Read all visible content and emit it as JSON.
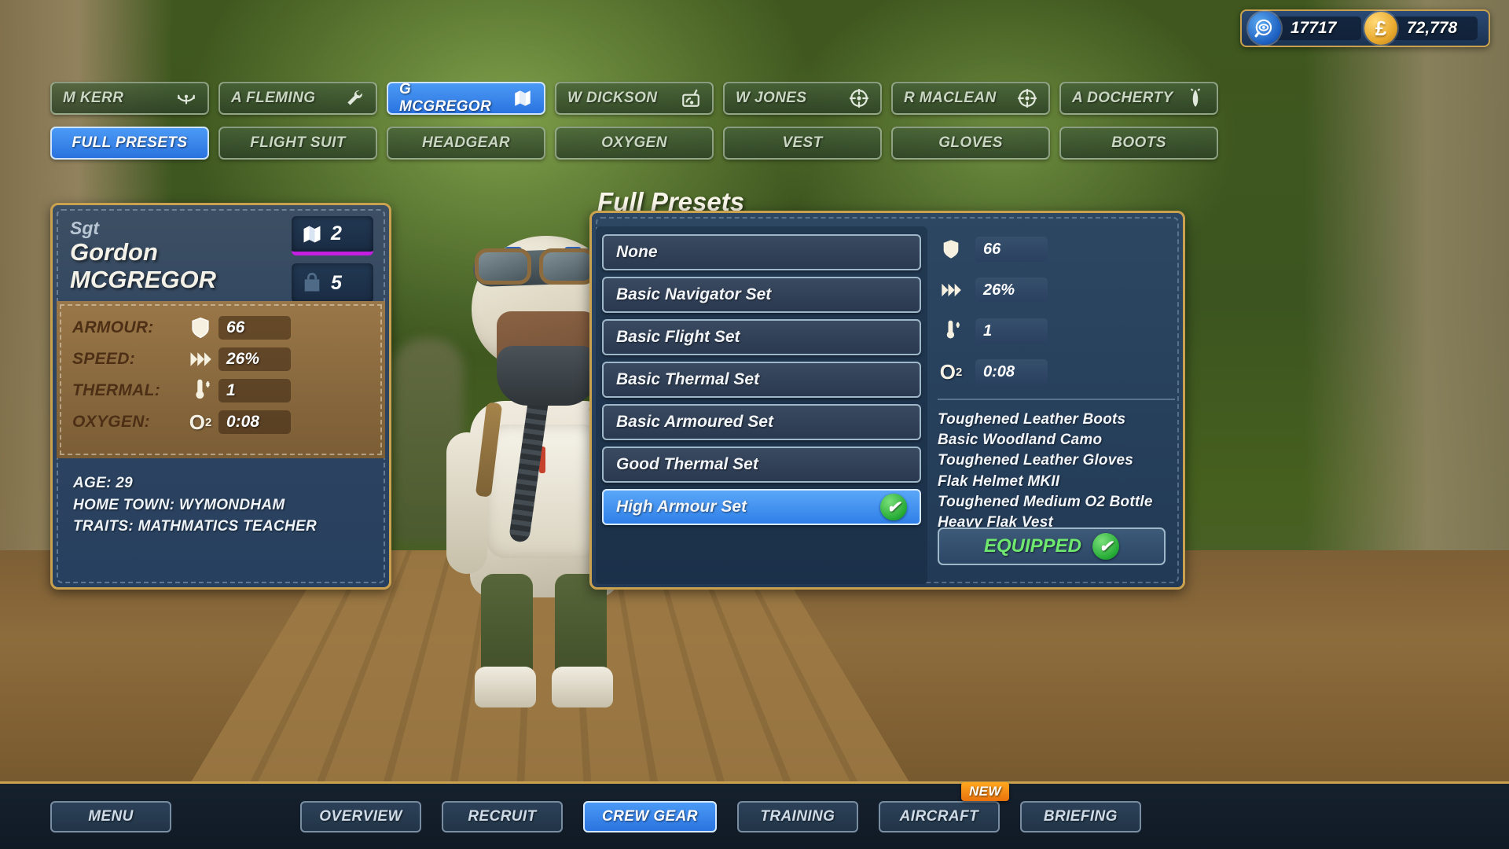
{
  "currency": {
    "research_icon": "research-eye-icon",
    "research_value": "17717",
    "money_icon": "pound-coin-icon",
    "money_symbol": "£",
    "money_value": "72,778"
  },
  "crew_tabs": [
    {
      "label": "M KERR",
      "icon": "yoke-icon",
      "active": false
    },
    {
      "label": "A FLEMING",
      "icon": "wrench-icon",
      "active": false
    },
    {
      "label": "G MCGREGOR",
      "icon": "map-icon",
      "active": true
    },
    {
      "label": "W DICKSON",
      "icon": "radio-icon",
      "active": false
    },
    {
      "label": "W JONES",
      "icon": "crosshair-icon",
      "active": false
    },
    {
      "label": "R MACLEAN",
      "icon": "crosshair-icon",
      "active": false
    },
    {
      "label": "A DOCHERTY",
      "icon": "bomb-icon",
      "active": false
    }
  ],
  "category_tabs": [
    {
      "label": "FULL PRESETS",
      "active": true
    },
    {
      "label": "FLIGHT SUIT",
      "active": false
    },
    {
      "label": "HEADGEAR",
      "active": false
    },
    {
      "label": "OXYGEN",
      "active": false
    },
    {
      "label": "VEST",
      "active": false
    },
    {
      "label": "GLOVES",
      "active": false
    },
    {
      "label": "BOOTS",
      "active": false
    }
  ],
  "character": {
    "rank": "Sgt",
    "first_name": "Gordon",
    "last_name": "MCGREGOR",
    "role_badge": {
      "icon": "map-icon",
      "value": "2",
      "accent": "#c41fe0"
    },
    "bag_badge": {
      "icon": "bag-icon",
      "value": "5"
    },
    "stats": [
      {
        "label": "ARMOUR:",
        "icon": "shield-icon",
        "value": "66"
      },
      {
        "label": "SPEED:",
        "icon": "chevrons-icon",
        "value": "26%"
      },
      {
        "label": "THERMAL:",
        "icon": "thermometer-icon",
        "value": "1"
      },
      {
        "label": "OXYGEN:",
        "icon": "o2-icon",
        "value": "0:08"
      }
    ],
    "bio": [
      "AGE: 29",
      "HOME TOWN: WYMONDHAM",
      "TRAITS: MATHMATICS TEACHER"
    ]
  },
  "presets_panel": {
    "title": "Full Presets",
    "items": [
      {
        "label": "None",
        "selected": false
      },
      {
        "label": "Basic Navigator Set",
        "selected": false
      },
      {
        "label": "Basic Flight Set",
        "selected": false
      },
      {
        "label": "Basic Thermal Set",
        "selected": false
      },
      {
        "label": "Basic Armoured Set",
        "selected": false
      },
      {
        "label": "Good Thermal Set",
        "selected": false
      },
      {
        "label": "High Armour Set",
        "selected": true
      }
    ],
    "detail_stats": [
      {
        "icon": "shield-icon",
        "value": "66"
      },
      {
        "icon": "chevrons-icon",
        "value": "26%"
      },
      {
        "icon": "thermometer-icon",
        "value": "1"
      },
      {
        "icon": "o2-icon",
        "value": "0:08"
      }
    ],
    "equipment": [
      "Toughened Leather Boots",
      "Basic Woodland Camo",
      "Toughened Leather Gloves",
      "Flak Helmet MKII",
      "Toughened Medium O2 Bottle",
      "Heavy Flak Vest"
    ],
    "equipped_label": "EQUIPPED"
  },
  "bottom_nav": [
    {
      "label": "MENU",
      "active": false,
      "badge": ""
    },
    {
      "label": "OVERVIEW",
      "active": false,
      "badge": ""
    },
    {
      "label": "RECRUIT",
      "active": false,
      "badge": ""
    },
    {
      "label": "CREW GEAR",
      "active": true,
      "badge": ""
    },
    {
      "label": "TRAINING",
      "active": false,
      "badge": ""
    },
    {
      "label": "AIRCRAFT",
      "active": false,
      "badge": "NEW"
    },
    {
      "label": "BRIEFING",
      "active": false,
      "badge": ""
    }
  ],
  "colors": {
    "accent_blue": "#3f8df0",
    "gold_border": "#caa24f",
    "leather_brown": "#8a6a3f",
    "panel_navy": "#27405c",
    "green_check": "#24aa34",
    "new_orange": "#e8720d",
    "rank_purple": "#c41fe0"
  }
}
